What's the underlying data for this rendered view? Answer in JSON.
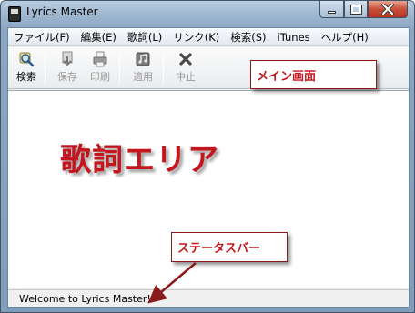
{
  "window": {
    "title": "Lyrics Master"
  },
  "menubar": {
    "items": [
      {
        "label": "ファイル(F)"
      },
      {
        "label": "編集(E)"
      },
      {
        "label": "歌詞(L)"
      },
      {
        "label": "リンク(K)"
      },
      {
        "label": "検索(S)"
      },
      {
        "label": "iTunes"
      },
      {
        "label": "ヘルプ(H)"
      }
    ]
  },
  "toolbar": {
    "search_label": "検索",
    "save_label": "保存",
    "print_label": "印刷",
    "apply_label": "適用",
    "stop_label": "中止"
  },
  "annotations": {
    "main_screen": "メイン画面",
    "lyrics_area": "歌詞エリア",
    "status_bar": "ステータスバー"
  },
  "statusbar": {
    "text": "Welcome to Lyrics Master!"
  },
  "colors": {
    "annotation_red": "#c4161c",
    "titlebar_blue": "#9fb8d1",
    "close_red": "#c7503a"
  }
}
